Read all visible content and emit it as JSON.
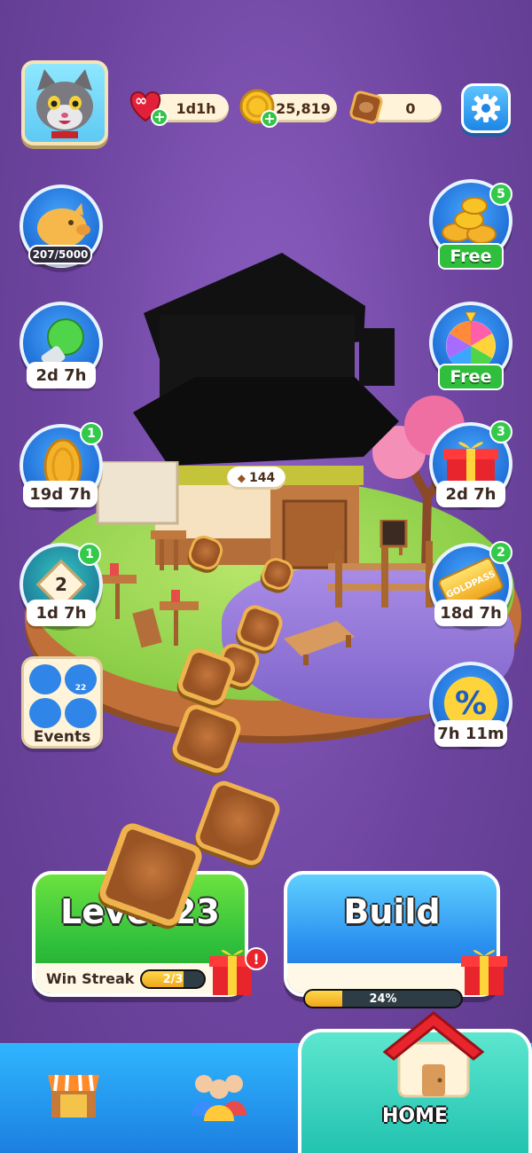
{
  "top_bar": {
    "lives": "1d1h",
    "lives_symbol": "∞",
    "coins": "25,819",
    "tokens": "0"
  },
  "left_column": {
    "piggy_bank": {
      "progress": "207/5000"
    },
    "booster_timer": "2d 7h",
    "coin_event": {
      "timer": "19d 7h",
      "badge": "1"
    },
    "race_event": {
      "timer": "1d 7h",
      "badge": "1",
      "rank": "2"
    },
    "events": {
      "label": "Events",
      "chest_count": "22"
    }
  },
  "right_column": {
    "free_coins": {
      "label": "Free",
      "badge": "5"
    },
    "wheel": {
      "label": "Free"
    },
    "gift": {
      "timer": "2d 7h",
      "badge": "3"
    },
    "gold_pass": {
      "timer": "18d 7h",
      "badge": "2",
      "ticket_text": "GOLDPASS"
    },
    "sale": {
      "timer": "7h 11m",
      "symbol": "%"
    }
  },
  "island": {
    "tile_counter": "144"
  },
  "level_button": {
    "label": "Level 23",
    "streak_label": "Win Streak",
    "streak_value": "2/3",
    "streak_fraction": 0.667,
    "alert": "!"
  },
  "build_button": {
    "label": "Build",
    "progress_text": "24%",
    "progress_fraction": 0.24
  },
  "bottom_nav": {
    "home_label": "HOME"
  },
  "colors": {
    "background": "#6d449f",
    "level_green": "#2fbf3c",
    "build_blue": "#2a8ff0",
    "home_teal": "#22c3b0"
  }
}
